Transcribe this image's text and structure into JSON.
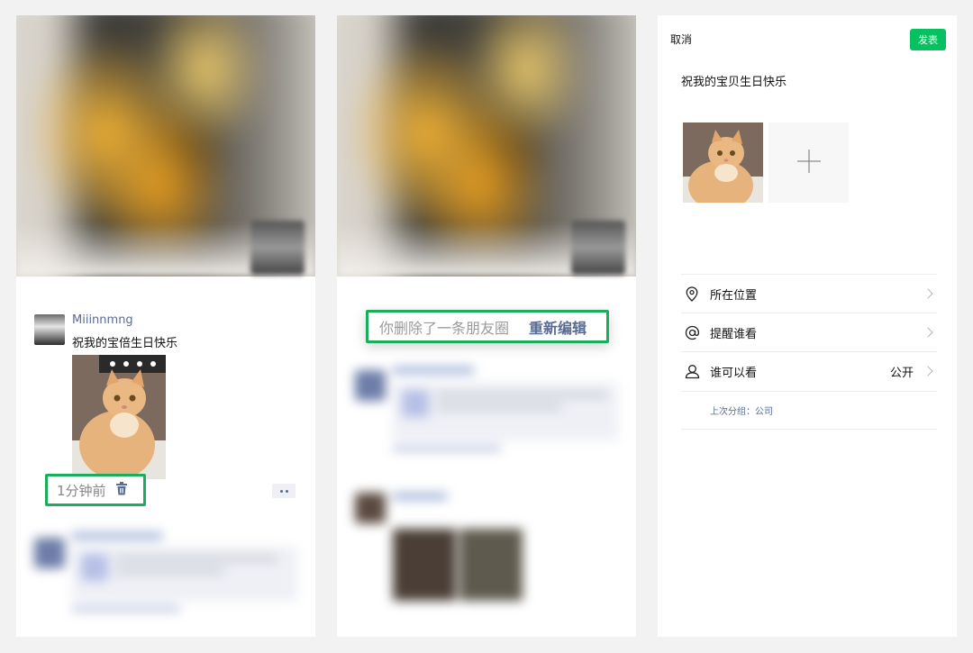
{
  "panel1": {
    "username": "Miiinnmng",
    "post_text": "祝我的宝倍生日快乐",
    "time": "1分钟前",
    "delete_icon": "trash-icon",
    "more_icon": "more-dots-icon",
    "highlight_color": "#1aad5c"
  },
  "panel2": {
    "toast_text": "你删除了一条朋友圈",
    "toast_action": "重新编辑",
    "highlight_color": "#1aad5c"
  },
  "panel3": {
    "cancel_label": "取消",
    "publish_label": "发表",
    "publish_color": "#07c160",
    "compose_text": "祝我的宝贝生日快乐",
    "add_icon": "plus-icon",
    "rows": [
      {
        "icon": "location-pin-icon",
        "label": "所在位置",
        "value": ""
      },
      {
        "icon": "at-icon",
        "label": "提醒谁看",
        "value": ""
      },
      {
        "icon": "person-icon",
        "label": "谁可以看",
        "value": "公开"
      }
    ],
    "last_group": "上次分组：公司"
  },
  "colors": {
    "link": "#576b95",
    "background": "#f2f2f2"
  }
}
